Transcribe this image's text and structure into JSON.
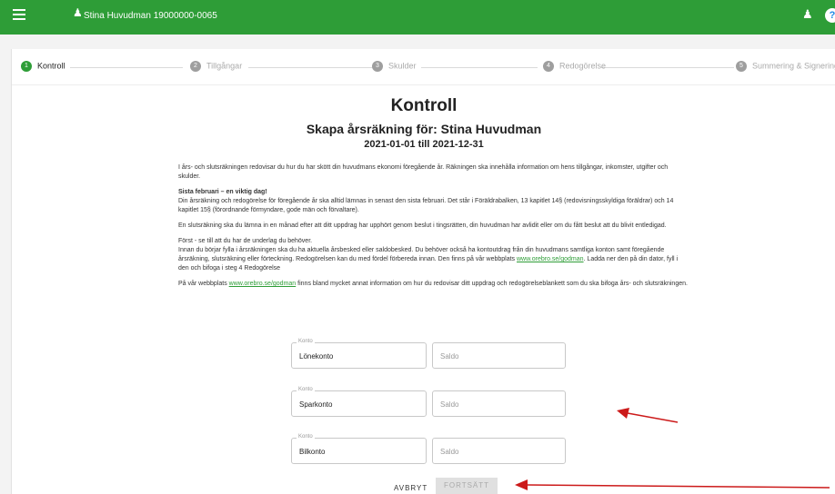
{
  "header": {
    "user_label": "Stina Huvudman 19000000-0065",
    "help_label": "?"
  },
  "steps": [
    {
      "number": "1",
      "label": "Kontroll",
      "active": true
    },
    {
      "number": "2",
      "label": "Tillgångar",
      "active": false
    },
    {
      "number": "3",
      "label": "Skulder",
      "active": false
    },
    {
      "number": "4",
      "label": "Redogörelse",
      "active": false
    },
    {
      "number": "5",
      "label": "Summering & Signering",
      "active": false
    }
  ],
  "main": {
    "title": "Kontroll",
    "subtitle": "Skapa årsräkning för: Stina Huvudman",
    "period": "2021-01-01 till 2021-12-31",
    "para1": "I års- och slutsräkningen redovisar du hur du har skött din huvudmans ekonomi föregående år. Räkningen ska innehålla information om hens tillgångar, inkomster, utgifter och skulder.",
    "para2_heading": "Sista februari – en viktig dag!",
    "para2_body": "Din årsräkning och redogörelse för föregående år ska alltid lämnas in senast den sista februari. Det står i Föräldrabalken, 13 kapitlet 14§ (redovisningsskyldiga föräldrar) och 14 kapitlet 15§ (förordnande förmyndare, gode män och förvaltare).",
    "para3": "En slutsräkning ska du lämna in en månad efter att ditt uppdrag har upphört genom beslut i tingsrätten, din huvudman har avlidit eller om du fått beslut att du blivit entledigad.",
    "para4_heading": "Först - se till att du har de underlag du behöver.",
    "para4_body": "Innan du börjar fylla i årsräkningen ska du ha aktuella årsbesked eller saldobesked. Du behöver också ha kontoutdrag från din huvudmans samtliga konton samt föregående årsräkning, slutsräkning eller förteckning. Redogörelsen kan du med fördel förbereda innan. Den finns på vår webbplats",
    "para4_link": "www.orebro.se/godman",
    "para4_tail": ". Ladda ner den på din dator, fyll i den och bifoga i steg 4 Redogörelse",
    "para5_start": "På vår webbplats",
    "para5_link": "www.orebro.se/godman",
    "para5_tail": "finns bland mycket annat information om hur du redovisar ditt uppdrag och redogörelseblankett som du ska bifoga års- och slutsräkningen."
  },
  "accounts": [
    {
      "label": "Konto",
      "value": "Lönekonto",
      "saldo_placeholder": "Saldo"
    },
    {
      "label": "Konto",
      "value": "Sparkonto",
      "saldo_placeholder": "Saldo"
    },
    {
      "label": "Konto",
      "value": "Bilkonto",
      "saldo_placeholder": "Saldo"
    }
  ],
  "actions": {
    "cancel_label": "AVBRYT",
    "continue_label": "FORTSÄTT"
  },
  "colors": {
    "brand_green": "#2e9d37",
    "annotation_red": "#cc1a1a"
  }
}
